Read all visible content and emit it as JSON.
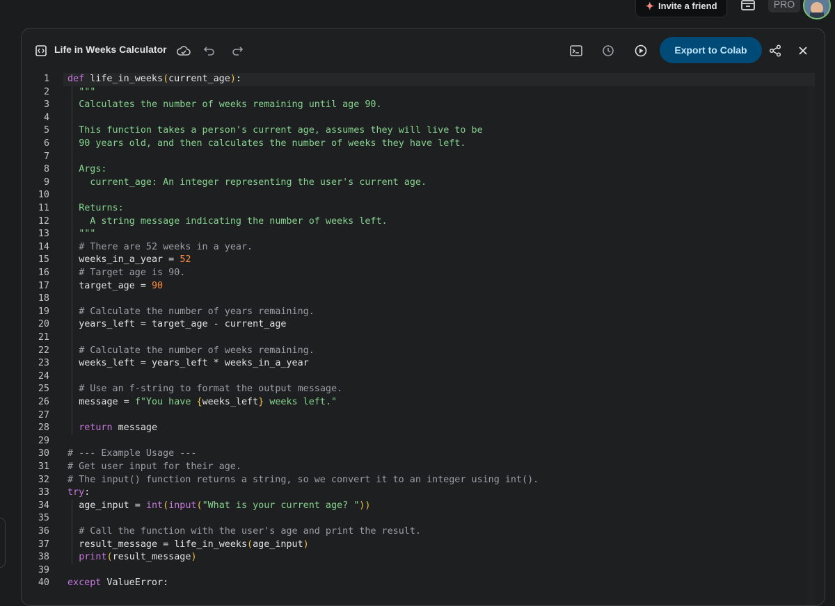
{
  "topbar": {
    "invite_label": "Invite a friend",
    "pro_label": "PRO"
  },
  "panel": {
    "title": "Life in Weeks Calculator",
    "export_label": "Export to Colab"
  },
  "code": {
    "lines": [
      {
        "n": "1",
        "i": 0,
        "t": [
          [
            "kw",
            "def "
          ],
          [
            "fn",
            "life_in_weeks"
          ],
          [
            "br",
            "("
          ],
          [
            "",
            "current_age"
          ],
          [
            "br",
            ")"
          ],
          [
            "",
            ":"
          ]
        ]
      },
      {
        "n": "2",
        "i": 1,
        "t": [
          [
            "str",
            "\"\"\""
          ]
        ]
      },
      {
        "n": "3",
        "i": 1,
        "t": [
          [
            "str",
            "Calculates the number of weeks remaining until age 90."
          ]
        ]
      },
      {
        "n": "4",
        "i": 0,
        "t": []
      },
      {
        "n": "5",
        "i": 1,
        "t": [
          [
            "str",
            "This function takes a person's current age, assumes they will live to be"
          ]
        ]
      },
      {
        "n": "6",
        "i": 1,
        "t": [
          [
            "str",
            "90 years old, and then calculates the number of weeks they have left."
          ]
        ]
      },
      {
        "n": "7",
        "i": 0,
        "t": []
      },
      {
        "n": "8",
        "i": 1,
        "t": [
          [
            "str",
            "Args:"
          ]
        ]
      },
      {
        "n": "9",
        "i": 1,
        "t": [
          [
            "str",
            "  current_age: An integer representing the user's current age."
          ]
        ]
      },
      {
        "n": "10",
        "i": 0,
        "t": []
      },
      {
        "n": "11",
        "i": 1,
        "t": [
          [
            "str",
            "Returns:"
          ]
        ]
      },
      {
        "n": "12",
        "i": 1,
        "t": [
          [
            "str",
            "  A string message indicating the number of weeks left."
          ]
        ]
      },
      {
        "n": "13",
        "i": 1,
        "t": [
          [
            "str",
            "\"\"\""
          ]
        ]
      },
      {
        "n": "14",
        "i": 1,
        "t": [
          [
            "cm",
            "# There are 52 weeks in a year."
          ]
        ]
      },
      {
        "n": "15",
        "i": 1,
        "t": [
          [
            "",
            "weeks_in_a_year = "
          ],
          [
            "num",
            "52"
          ]
        ]
      },
      {
        "n": "16",
        "i": 1,
        "t": [
          [
            "cm",
            "# Target age is 90."
          ]
        ]
      },
      {
        "n": "17",
        "i": 1,
        "t": [
          [
            "",
            "target_age = "
          ],
          [
            "num",
            "90"
          ]
        ]
      },
      {
        "n": "18",
        "i": 0,
        "t": []
      },
      {
        "n": "19",
        "i": 1,
        "t": [
          [
            "cm",
            "# Calculate the number of years remaining."
          ]
        ]
      },
      {
        "n": "20",
        "i": 1,
        "t": [
          [
            "",
            "years_left = target_age - current_age"
          ]
        ]
      },
      {
        "n": "21",
        "i": 0,
        "t": []
      },
      {
        "n": "22",
        "i": 1,
        "t": [
          [
            "cm",
            "# Calculate the number of weeks remaining."
          ]
        ]
      },
      {
        "n": "23",
        "i": 1,
        "t": [
          [
            "",
            "weeks_left = years_left * weeks_in_a_year"
          ]
        ]
      },
      {
        "n": "24",
        "i": 0,
        "t": []
      },
      {
        "n": "25",
        "i": 1,
        "t": [
          [
            "cm",
            "# Use an f-string to format the output message."
          ]
        ]
      },
      {
        "n": "26",
        "i": 1,
        "t": [
          [
            "",
            "message = "
          ],
          [
            "str",
            "f\"You have "
          ],
          [
            "br",
            "{"
          ],
          [
            "",
            "weeks_left"
          ],
          [
            "br",
            "}"
          ],
          [
            "str",
            " weeks left.\""
          ]
        ]
      },
      {
        "n": "27",
        "i": 0,
        "t": []
      },
      {
        "n": "28",
        "i": 1,
        "t": [
          [
            "kw",
            "return"
          ],
          [
            "",
            " message"
          ]
        ]
      },
      {
        "n": "29",
        "i": 0,
        "t": []
      },
      {
        "n": "30",
        "i": 0,
        "t": [
          [
            "cm",
            "# --- Example Usage ---"
          ]
        ]
      },
      {
        "n": "31",
        "i": 0,
        "t": [
          [
            "cm",
            "# Get user input for their age."
          ]
        ]
      },
      {
        "n": "32",
        "i": 0,
        "t": [
          [
            "cm",
            "# The input() function returns a string, so we convert it to an integer using int()."
          ]
        ]
      },
      {
        "n": "33",
        "i": 0,
        "t": [
          [
            "kw",
            "try"
          ],
          [
            "",
            ":"
          ]
        ]
      },
      {
        "n": "34",
        "i": 1,
        "t": [
          [
            "",
            "age_input = "
          ],
          [
            "kw",
            "int"
          ],
          [
            "br",
            "("
          ],
          [
            "kw",
            "input"
          ],
          [
            "br",
            "("
          ],
          [
            "str",
            "\"What is your current age? \""
          ],
          [
            "br",
            "))"
          ]
        ]
      },
      {
        "n": "35",
        "i": 0,
        "t": []
      },
      {
        "n": "36",
        "i": 1,
        "t": [
          [
            "cm",
            "# Call the function with the user's age and print the result."
          ]
        ]
      },
      {
        "n": "37",
        "i": 1,
        "t": [
          [
            "",
            "result_message = life_in_weeks"
          ],
          [
            "br",
            "("
          ],
          [
            "",
            "age_input"
          ],
          [
            "br",
            ")"
          ]
        ]
      },
      {
        "n": "38",
        "i": 1,
        "t": [
          [
            "kw",
            "print"
          ],
          [
            "br",
            "("
          ],
          [
            "",
            "result_message"
          ],
          [
            "br",
            ")"
          ]
        ]
      },
      {
        "n": "39",
        "i": 0,
        "t": []
      },
      {
        "n": "40",
        "i": 0,
        "t": [
          [
            "kw",
            "except"
          ],
          [
            "",
            " ValueError:"
          ]
        ]
      }
    ]
  }
}
